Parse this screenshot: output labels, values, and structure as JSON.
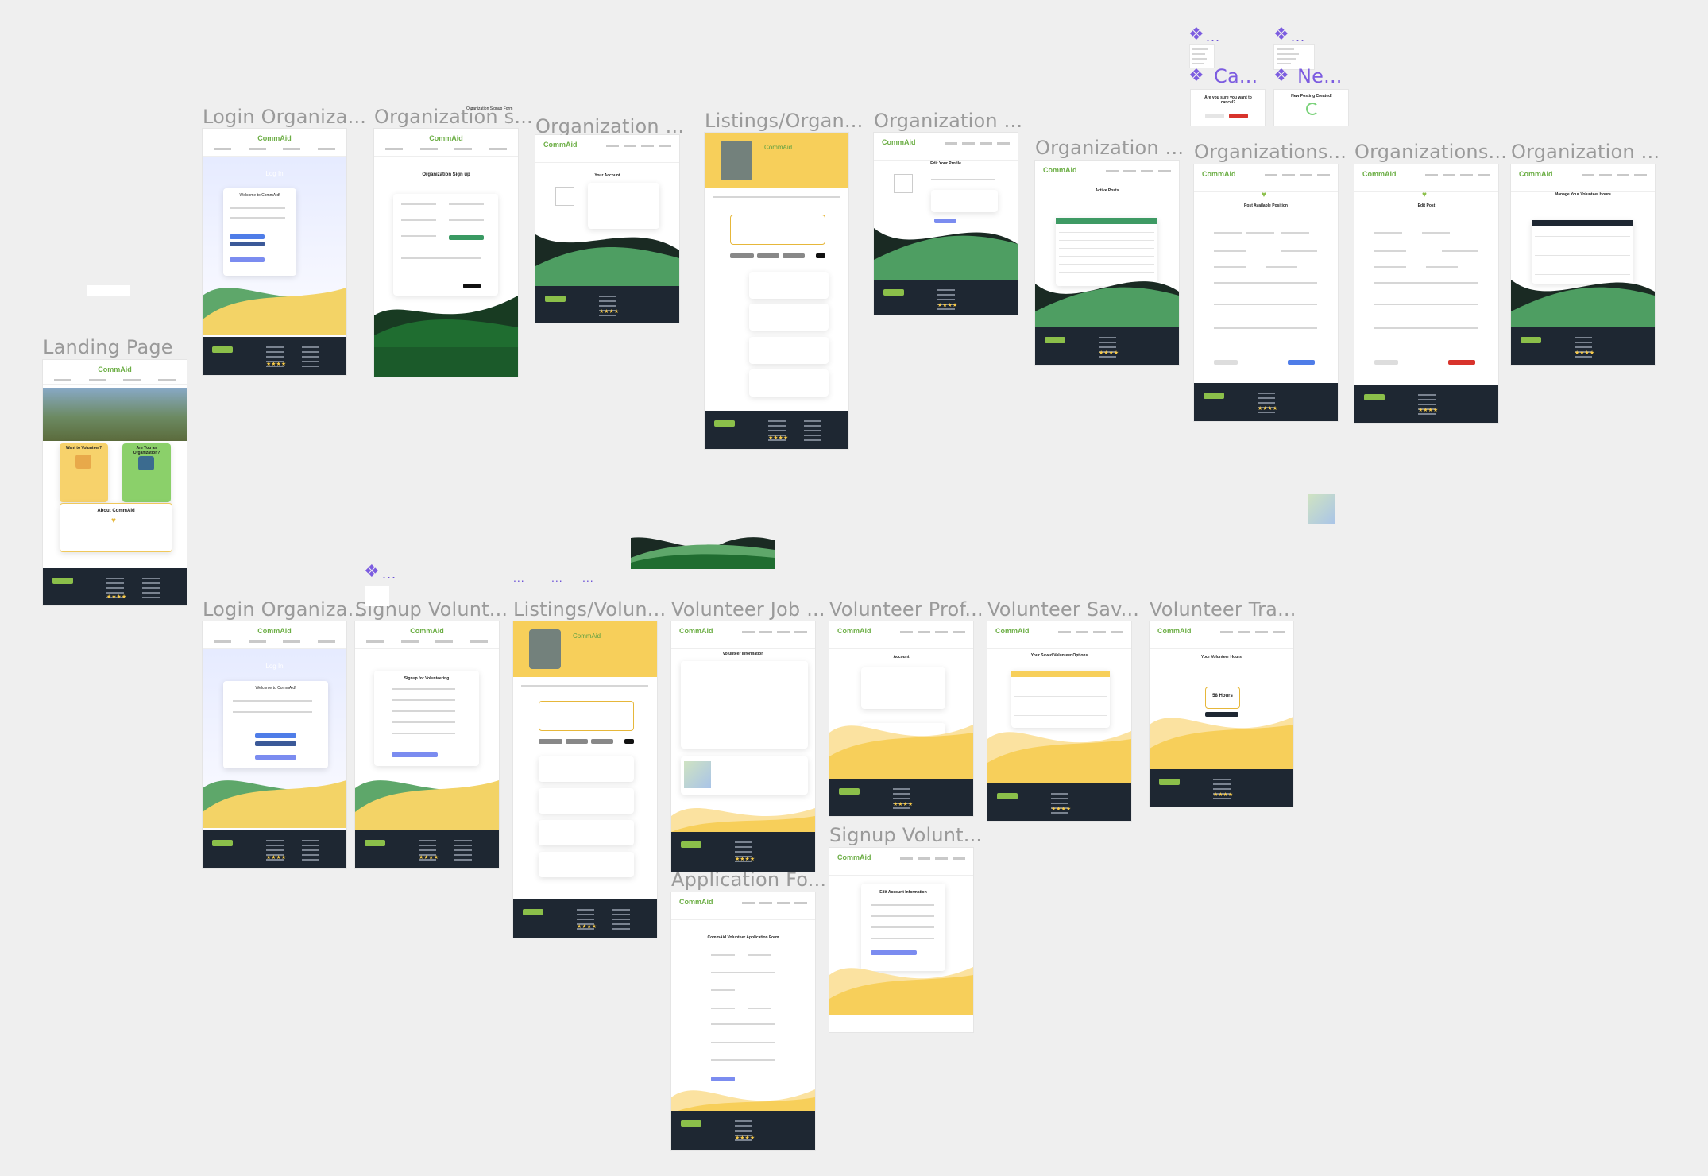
{
  "canvas": {
    "background": "#efefef"
  },
  "frames": [
    {
      "key": "landing",
      "title": "Landing Page"
    },
    {
      "key": "login_org_1",
      "title": "Login Organiza..."
    },
    {
      "key": "org_signup",
      "title": "Organization s..."
    },
    {
      "key": "org_account",
      "title": "Organization ..."
    },
    {
      "key": "listings_org",
      "title": "Listings/Organ..."
    },
    {
      "key": "org_edit_profile",
      "title": "Organization ..."
    },
    {
      "key": "org_active_posts",
      "title": "Organization ..."
    },
    {
      "key": "orgs_post",
      "title": "Organizations..."
    },
    {
      "key": "orgs_edit_post",
      "title": "Organizations..."
    },
    {
      "key": "org_manage_hours",
      "title": "Organization ..."
    },
    {
      "key": "login_org_2",
      "title": "Login Organiza..."
    },
    {
      "key": "signup_vol",
      "title": "Signup Volunt..."
    },
    {
      "key": "listings_vol",
      "title": "Listings/Volun..."
    },
    {
      "key": "vol_job",
      "title": "Volunteer Job ..."
    },
    {
      "key": "vol_profile",
      "title": "Volunteer Prof..."
    },
    {
      "key": "vol_saved",
      "title": "Volunteer Sav..."
    },
    {
      "key": "vol_tracker",
      "title": "Volunteer Tra..."
    },
    {
      "key": "signup_vol_2",
      "title": "Signup Volunt..."
    },
    {
      "key": "application",
      "title": "Application Fo..."
    }
  ],
  "components": [
    {
      "key": "cancel",
      "title": "Ca...",
      "dots": "..."
    },
    {
      "key": "new",
      "title": "Ne...",
      "dots": "..."
    }
  ],
  "orphan_dots": [
    "...",
    "...",
    "...",
    "...",
    "..."
  ],
  "brand": {
    "name": "CommAid",
    "green": "#4a9a55",
    "dark_green": "#1c5c2c",
    "yellow": "#f7cf5a",
    "footer": "#1e2732",
    "accent": "#6b5be6"
  },
  "texts": {
    "landing_volunteer": "Want to Volunteer?",
    "landing_org": "Are You an Organization?",
    "landing_about": "About CommAid",
    "login_heading": "Log In",
    "login_welcome": "Welcome to CommAid!",
    "org_signup_heading": "Organization Sign up",
    "org_signup_small": "Organization Signup Form",
    "account_heading": "Your Account",
    "edit_profile_heading": "Edit Your Profile",
    "active_posts_heading": "Active Posts",
    "post_position_heading": "Post Available Position",
    "edit_post_heading": "Edit Post",
    "manage_hours_heading": "Manage Your Volunteer Hours",
    "signup_vol_heading": "Signup for Volunteering",
    "volunteer_info_heading": "Volunteer Information",
    "account_heading_vol": "Account",
    "saved_heading": "Your Saved Volunteer Options",
    "tracker_heading": "Your Volunteer Hours",
    "tracker_hours": "58 Hours",
    "edit_account_heading": "Edit Account Information",
    "application_heading": "CommAid Volunteer Application Form",
    "cancel_question": "Are you sure you want to cancel?",
    "new_posting": "New Posting Created!"
  }
}
